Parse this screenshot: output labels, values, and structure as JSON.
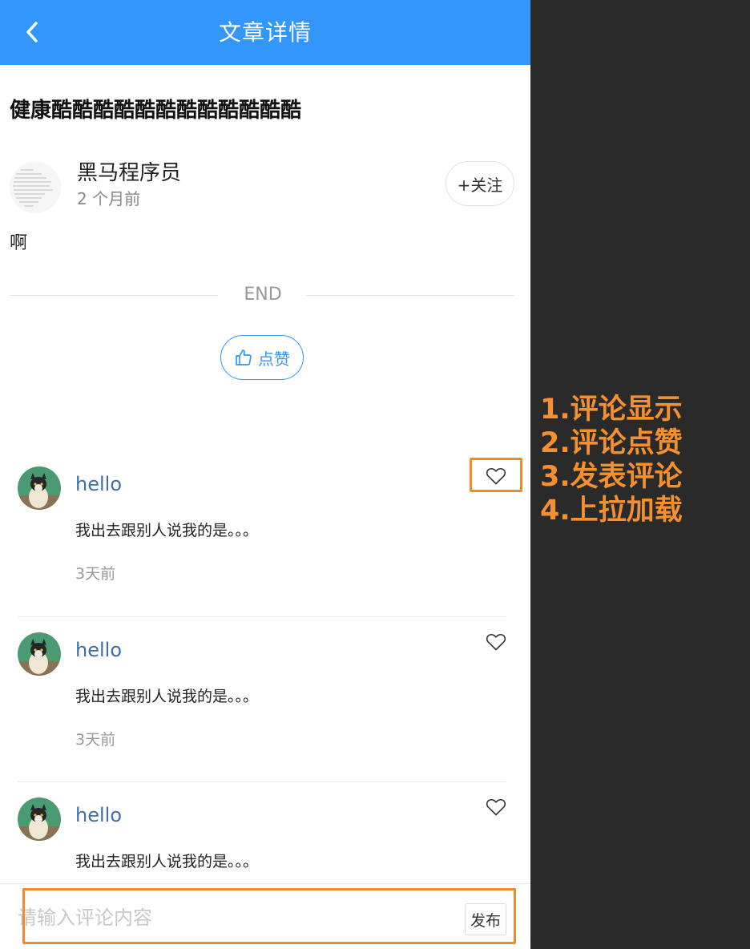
{
  "header": {
    "title": "文章详情",
    "back_icon": "chevron-left-icon",
    "background": "#3296fa"
  },
  "article": {
    "title": "健康酷酷酷酷酷酷酷酷酷酷酷酷",
    "author": {
      "name": "黑马程序员",
      "time": "2 个月前",
      "follow_label": "+关注"
    },
    "content": "啊",
    "end_text": "END",
    "like_label": "点赞",
    "like_icon": "thumbs-up-icon"
  },
  "comments": [
    {
      "user": "hello",
      "text": "我出去跟别人说我的是。。。",
      "time": "3天前",
      "liked": false
    },
    {
      "user": "hello",
      "text": "我出去跟别人说我的是。。。",
      "time": "3天前",
      "liked": false
    },
    {
      "user": "hello",
      "text": "我出去跟别人说我的是。。。",
      "time": "",
      "liked": false
    }
  ],
  "comment_bar": {
    "placeholder": "请输入评论内容",
    "value": "",
    "publish_label": "发布"
  },
  "annotations": {
    "items": [
      "1.评论显示",
      "2.评论点赞",
      "3.发表评论",
      "4.上拉加载"
    ],
    "color": "#f5902e"
  }
}
